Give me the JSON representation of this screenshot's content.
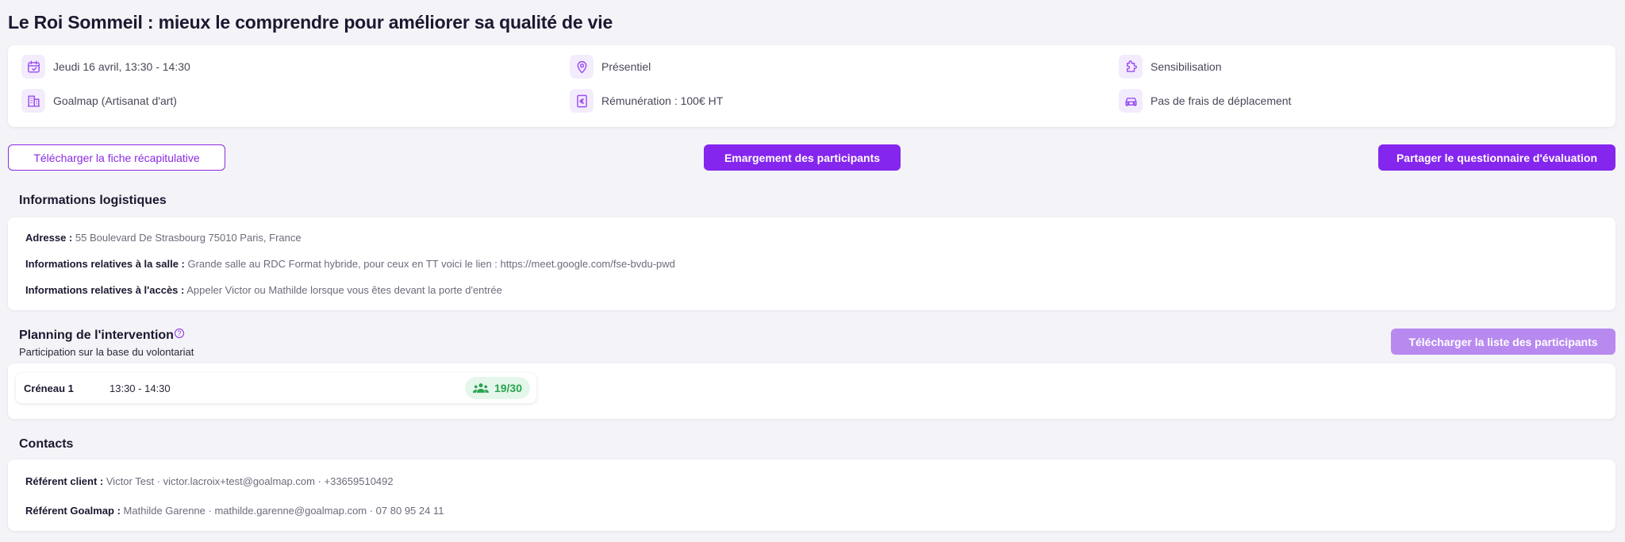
{
  "page": {
    "title": "Le Roi Sommeil : mieux le comprendre pour améliorer sa qualité de vie"
  },
  "info": {
    "date": "Jeudi 16 avril, 13:30 - 14:30",
    "mode": "Présentiel",
    "category": "Sensibilisation",
    "company": "Goalmap (Artisanat d'art)",
    "remuneration": "Rémunération : 100€ HT",
    "travel": "Pas de frais de déplacement"
  },
  "actions": {
    "download_summary": "Télécharger la fiche récapitulative",
    "attendance": "Emargement des participants",
    "share_questionnaire": "Partager le questionnaire d'évaluation"
  },
  "logistics": {
    "title": "Informations logistiques",
    "address_label": "Adresse :",
    "address_value": "55 Boulevard De Strasbourg 75010 Paris, France",
    "room_label": "Informations relatives à la salle :",
    "room_value": "Grande salle au RDC Format hybride, pour ceux en TT voici le lien : https://meet.google.com/fse-bvdu-pwd",
    "access_label": "Informations relatives à l'accès :",
    "access_value": "Appeler Victor ou Mathilde lorsque vous êtes devant la porte d'entrée"
  },
  "planning": {
    "title": "Planning de l'intervention",
    "help_glyph": "?",
    "subtitle": "Participation sur la base du volontariat",
    "download_list": "Télécharger la liste des participants",
    "slots": [
      {
        "name": "Créneau 1",
        "time": "13:30 - 14:30",
        "count": "19/30"
      }
    ]
  },
  "contacts": {
    "title": "Contacts",
    "client_label": "Référent client :",
    "client_value": "Victor Test · victor.lacroix+test@goalmap.com · +33659510492",
    "goalmap_label": "Référent Goalmap :",
    "goalmap_value": "Mathilde Garenne · mathilde.garenne@goalmap.com · 07 80 95 24 11"
  },
  "colors": {
    "accent": "#8526ee",
    "accent_light": "#b88af0",
    "icon_bg": "#f3ecfd",
    "success": "#27a450",
    "success_bg": "#e5f6ea"
  },
  "icons": [
    "calendar-icon",
    "location-pin-icon",
    "puzzle-icon",
    "building-icon",
    "euro-note-icon",
    "car-icon",
    "help-icon",
    "people-icon"
  ]
}
